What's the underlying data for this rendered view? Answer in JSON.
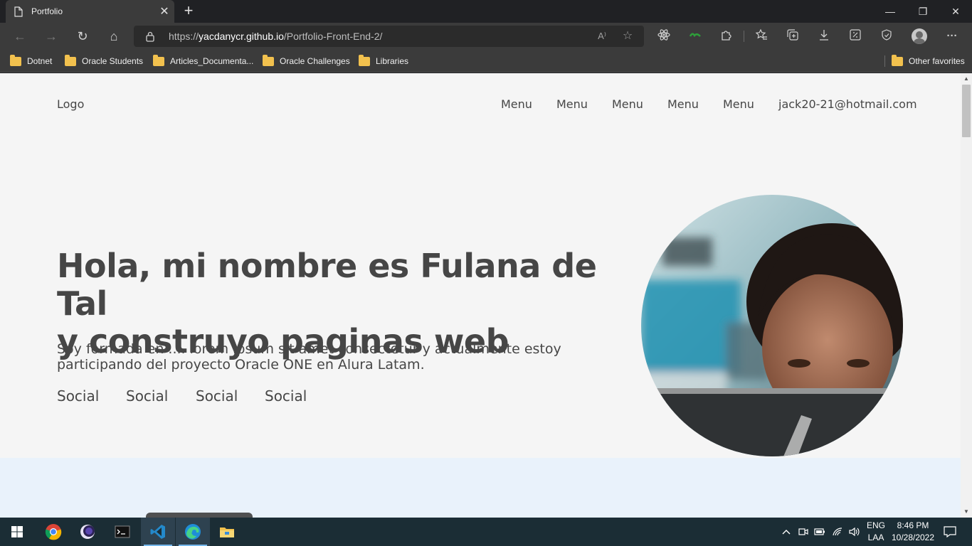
{
  "browser": {
    "tab": {
      "title": "Portfolio",
      "close": "✕"
    },
    "new_tab": "+",
    "window_controls": {
      "minimize": "—",
      "restore": "❐",
      "close": "✕"
    },
    "nav": {
      "back": "←",
      "forward": "→",
      "refresh": "↻",
      "home": "⌂"
    },
    "url": {
      "prefix": "https://",
      "host": "yacdanycr.github.io",
      "path": "/Portfolio-Front-End-2/"
    },
    "url_icons": {
      "read_aloud": "A⁾",
      "add_favorite": "☆"
    },
    "toolbar_icons": [
      "react-devtools-icon",
      "extension-green-icon",
      "extensions-icon",
      "favorites-icon",
      "collections-icon",
      "downloads-icon",
      "math-solver-icon",
      "browser-essentials-icon",
      "profile-icon",
      "more-icon"
    ],
    "menu_dots": "···",
    "favorites": [
      {
        "label": "Dotnet"
      },
      {
        "label": "Oracle Students"
      },
      {
        "label": "Articles_Documenta..."
      },
      {
        "label": "Oracle Challenges"
      },
      {
        "label": "Libraries"
      }
    ],
    "other_favorites": "Other favorites"
  },
  "page": {
    "logo": "Logo",
    "menu": [
      "Menu",
      "Menu",
      "Menu",
      "Menu",
      "Menu"
    ],
    "email": "jack20-21@hotmail.com",
    "hero": {
      "title_line1": "Hola, mi nombre es Fulana de Tal",
      "title_line2": "y construyo paginas web",
      "text_line1": "Soy formada en .... lorem ipsum sit amet consectetur y actualmente estoy",
      "text_line2": "participando del proyecto Oracle ONE en Alura Latam."
    },
    "social": [
      "Social",
      "Social",
      "Social",
      "Social"
    ]
  },
  "taskbar": {
    "apps": [
      "windows-start-icon",
      "chrome-icon",
      "eclipse-icon",
      "terminal-icon",
      "vscode-icon",
      "edge-icon",
      "file-explorer-icon"
    ],
    "language": {
      "line1": "ENG",
      "line2": "LAA"
    },
    "time": "8:46 PM",
    "date": "10/28/2022"
  },
  "colors": {
    "page_bg": "#f5f5f5",
    "text": "#464646",
    "section2_bg": "#e9f2fb",
    "taskbar_bg": "#1b2d35",
    "browser_bg": "#3b3b3b"
  }
}
